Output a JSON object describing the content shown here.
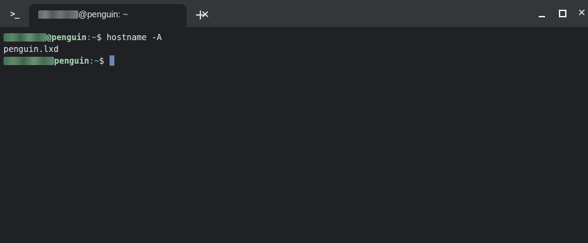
{
  "window": {
    "tab": {
      "title_suffix": "@penguin: ~",
      "close_glyph": "✕"
    },
    "launcher_glyph": ">_",
    "new_tab_glyph": "+",
    "controls": {
      "close_glyph": "✕"
    },
    "icons": [
      "terminal-icon",
      "close-icon",
      "plus-icon",
      "minimize-icon",
      "maximize-icon",
      "close-icon"
    ]
  },
  "terminal": {
    "line1": {
      "host": "@penguin",
      "path": ":~",
      "symbol": "$",
      "command": " hostname -A"
    },
    "line2": {
      "output": "penguin.lxd"
    },
    "line3": {
      "host": "penguin",
      "path": ":~",
      "symbol": "$"
    }
  },
  "colors": {
    "background": "#202124",
    "tabbar": "#35363a",
    "prompt_user": "#a8dab5",
    "prompt_path": "#8ab4f8",
    "cursor": "#6e84b6",
    "text": "#e8eaed"
  }
}
